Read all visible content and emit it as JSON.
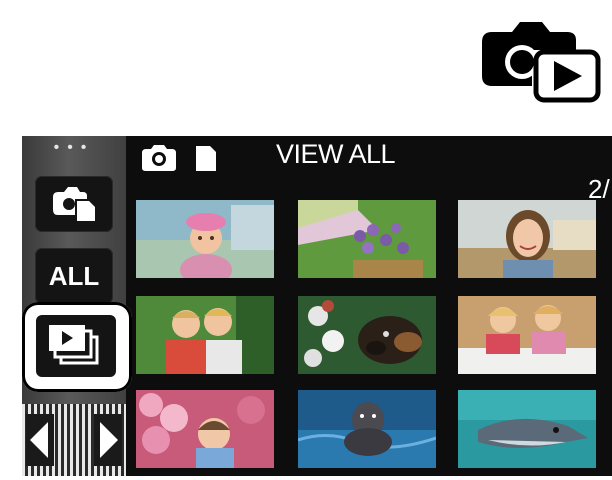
{
  "header": {
    "title": "VIEW ALL",
    "page_indicator": "2/"
  },
  "side_panel": {
    "all_label": "ALL",
    "icons": [
      "camera-video-icon",
      "playback-icon",
      "left-arrow-icon",
      "right-arrow-icon"
    ]
  },
  "mode_icon": "camera-playback-mode-icon",
  "thumbnails": [
    {
      "subject": "girl-with-pink-hat"
    },
    {
      "subject": "purple-flowers"
    },
    {
      "subject": "smiling-woman"
    },
    {
      "subject": "two-boys"
    },
    {
      "subject": "dog-with-flowers"
    },
    {
      "subject": "two-children-drawing"
    },
    {
      "subject": "baby-with-pink-flowers"
    },
    {
      "subject": "seal-in-water"
    },
    {
      "subject": "dolphin"
    }
  ],
  "colors": {
    "screen_bg": "#0d0d0d",
    "button_bg": "#141414",
    "text": "#ffffff"
  }
}
